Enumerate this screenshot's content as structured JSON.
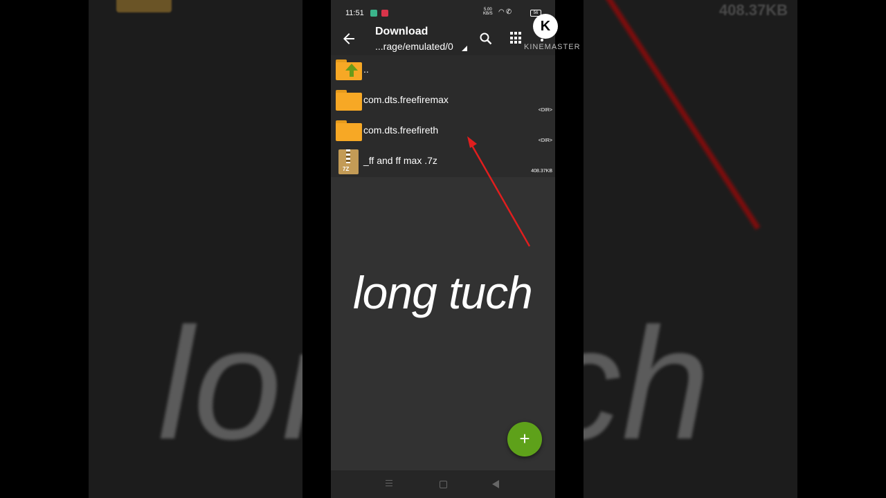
{
  "background": {
    "blur_text_left": "lon",
    "blur_text_right": "ch",
    "blur_size": "408.37KB"
  },
  "status_bar": {
    "time": "11:51",
    "net_speed_value": "5.00",
    "net_speed_unit": "KB/S",
    "icons": [
      "wifi-icon",
      "call-icon"
    ],
    "battery": "56"
  },
  "toolbar": {
    "title": "Download",
    "path": "...rage/emulated/0"
  },
  "files": [
    {
      "name": "..",
      "meta": "",
      "icon": "folder-up-icon"
    },
    {
      "name": "com.dts.freefiremax",
      "meta": "<DIR>",
      "icon": "folder-icon"
    },
    {
      "name": "com.dts.freefireth",
      "meta": "<DIR>",
      "icon": "folder-icon"
    },
    {
      "name": "_ff and ff max .7z",
      "meta": "408.37KB",
      "icon": "archive-icon",
      "icon_label": "7Z"
    }
  ],
  "overlay": {
    "caption": "long tuch"
  },
  "fab": {
    "label": "+"
  },
  "watermark": {
    "logo": "K",
    "text": "KINEMASTER"
  },
  "colors": {
    "folder": "#f7a825",
    "fab": "#5ea11a",
    "arrow": "#e01e1e"
  }
}
